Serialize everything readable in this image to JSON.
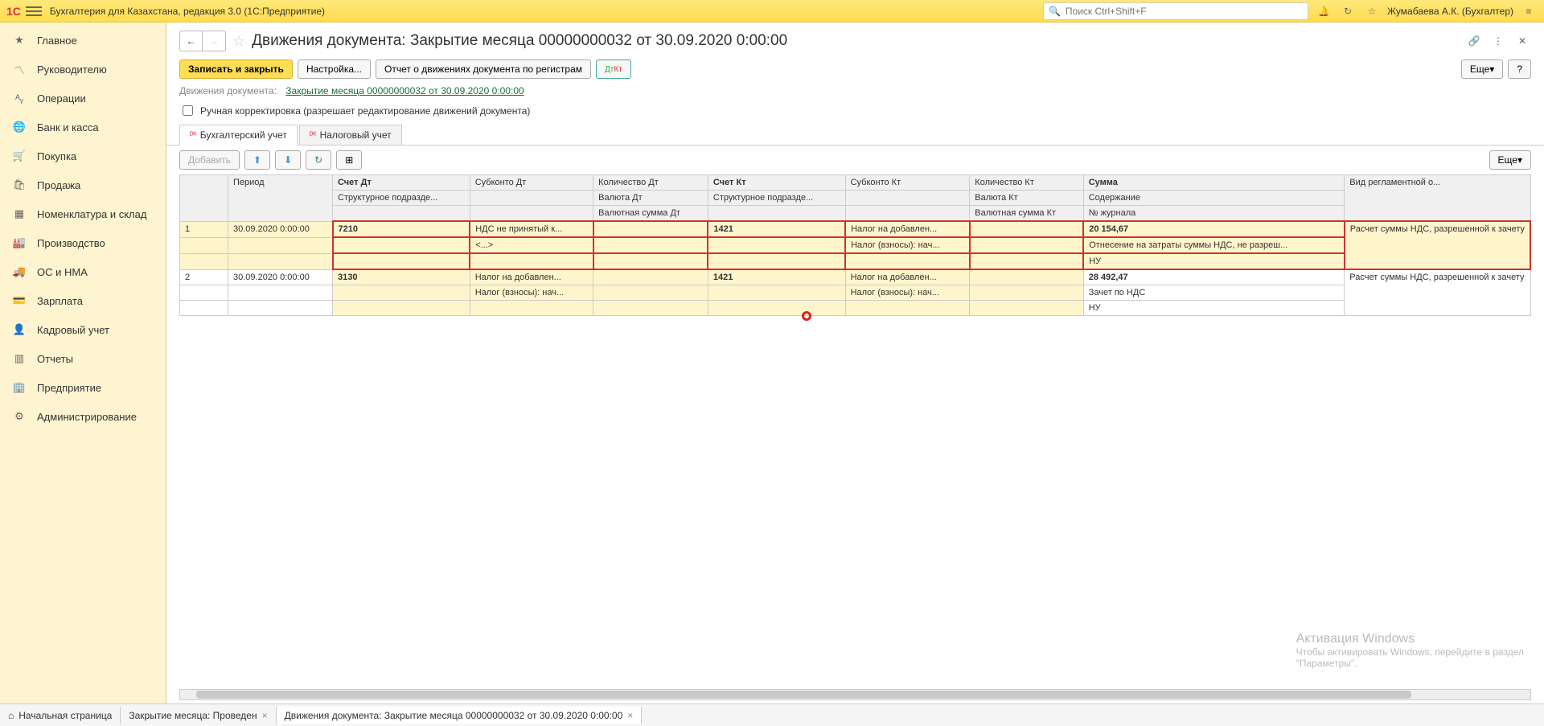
{
  "app": {
    "title": "Бухгалтерия для Казахстана, редакция 3.0  (1С:Предприятие)",
    "search_placeholder": "Поиск Ctrl+Shift+F",
    "user": "Жумабаева А.К. (Бухгалтер)"
  },
  "sidebar": {
    "items": [
      {
        "icon": "★",
        "label": "Главное"
      },
      {
        "icon": "📈",
        "label": "Руководителю"
      },
      {
        "icon": "⇄",
        "label": "Операции"
      },
      {
        "icon": "🌐",
        "label": "Банк и касса"
      },
      {
        "icon": "🛒",
        "label": "Покупка"
      },
      {
        "icon": "🛍",
        "label": "Продажа"
      },
      {
        "icon": "▦",
        "label": "Номенклатура и склад"
      },
      {
        "icon": "🏭",
        "label": "Производство"
      },
      {
        "icon": "🚚",
        "label": "ОС и НМА"
      },
      {
        "icon": "💳",
        "label": "Зарплата"
      },
      {
        "icon": "👤",
        "label": "Кадровый учет"
      },
      {
        "icon": "📊",
        "label": "Отчеты"
      },
      {
        "icon": "🏢",
        "label": "Предприятие"
      },
      {
        "icon": "⚙",
        "label": "Администрирование"
      }
    ]
  },
  "doc": {
    "title": "Движения документа: Закрытие месяца 00000000032 от 30.09.2020 0:00:00",
    "write_close": "Записать и закрыть",
    "settings": "Настройка...",
    "report": "Отчет о движениях документа по регистрам",
    "more": "Еще",
    "help": "?",
    "info_label": "Движения документа:",
    "info_link": "Закрытие месяца 00000000032 от 30.09.2020 0:00:00",
    "checkbox_label": "Ручная корректировка (разрешает редактирование движений документа)",
    "tab1": "Бухгалтерский учет",
    "tab2": "Налоговый учет",
    "add": "Добавить"
  },
  "grid": {
    "headers": {
      "period": "Период",
      "acct_dt": "Счет Дт",
      "sub_dt": "Субконто Дт",
      "qty_dt": "Количество Дт",
      "acct_kt": "Счет Кт",
      "sub_kt": "Субконто Кт",
      "qty_kt": "Количество Кт",
      "sum": "Сумма",
      "reg_type": "Вид регламентной о...",
      "struct": "Структурное подразде...",
      "cur_dt": "Валюта Дт",
      "cur_kt": "Валюта Кт",
      "content": "Содержание",
      "cur_sum_dt": "Валютная сумма Дт",
      "cur_sum_kt": "Валютная сумма Кт",
      "journal": "№ журнала"
    },
    "rows": [
      {
        "n": "1",
        "period": "30.09.2020 0:00:00",
        "acct_dt": "7210",
        "sub_dt": "НДС не принятый к...",
        "sub_dt2": "<...>",
        "acct_kt": "1421",
        "sub_kt": "Налог на добавлен...",
        "sub_kt2": "Налог (взносы): нач...",
        "sum": "20 154,67",
        "content": "Отнесение на затраты суммы НДС, не разреш...",
        "journal": "НУ",
        "reg": "Расчет суммы НДС, разрешенной к зачету"
      },
      {
        "n": "2",
        "period": "30.09.2020 0:00:00",
        "acct_dt": "3130",
        "sub_dt": "Налог на добавлен...",
        "sub_dt2": "Налог (взносы): нач...",
        "acct_kt": "1421",
        "sub_kt": "Налог на добавлен...",
        "sub_kt2": "Налог (взносы): нач...",
        "sum": "28 492,47",
        "content": "Зачет по НДС",
        "journal": "НУ",
        "reg": "Расчет суммы НДС, разрешенной к зачету"
      }
    ]
  },
  "bottom": {
    "home": "Начальная страница",
    "t1": "Закрытие месяца: Проведен",
    "t2": "Движения документа: Закрытие месяца 00000000032 от 30.09.2020 0:00:00"
  },
  "watermark": {
    "line1": "Активация Windows",
    "line2": "Чтобы активировать Windows, перейдите в раздел",
    "line3": "\"Параметры\"."
  }
}
